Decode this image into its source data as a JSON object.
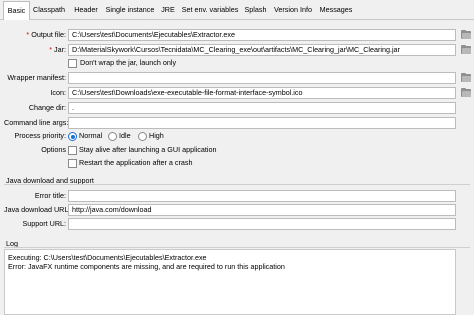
{
  "tabs": [
    {
      "label": "Basic",
      "active": true
    },
    {
      "label": "Classpath",
      "active": false
    },
    {
      "label": "Header",
      "active": false
    },
    {
      "label": "Single instance",
      "active": false
    },
    {
      "label": "JRE",
      "active": false
    },
    {
      "label": "Set env. variables",
      "active": false
    },
    {
      "label": "Splash",
      "active": false
    },
    {
      "label": "Version Info",
      "active": false
    },
    {
      "label": "Messages",
      "active": false
    }
  ],
  "basic": {
    "required_marker": "*",
    "output_file": {
      "label": "Output file:",
      "value": "C:\\Users\\test\\Documents\\Ejecutables\\Extractor.exe"
    },
    "jar": {
      "label": "Jar:",
      "value": "D:\\MaterialSkywork\\Cursos\\Tecnidata\\MC_Clearing_exe\\out\\artifacts\\MC_Clearing_jar\\MC_Clearing.jar"
    },
    "dont_wrap_label": "Don't wrap the jar, launch only",
    "wrapper_manifest": {
      "label": "Wrapper manifest:",
      "value": ""
    },
    "icon": {
      "label": "Icon:",
      "value": "C:\\Users\\test\\Downloads\\exe-executable-file-format-interface-symbol.ico"
    },
    "change_dir": {
      "label": "Change dir:",
      "value": "."
    },
    "command_line_args": {
      "label": "Command line args:",
      "value": ""
    },
    "process_priority": {
      "label": "Process priority:",
      "options": [
        "Normal",
        "Idle",
        "High"
      ],
      "selected": "Normal"
    },
    "options": {
      "label": "Options",
      "stay_alive": "Stay alive after launching a GUI application",
      "restart": "Restart the application after a crash"
    }
  },
  "java_download": {
    "section_title": "Java download and support",
    "error_title": {
      "label": "Error title:",
      "value": ""
    },
    "download_url": {
      "label": "Java download URL:",
      "value": "http://java.com/download"
    },
    "support_url": {
      "label": "Support URL:",
      "value": ""
    }
  },
  "log": {
    "section_title": "Log",
    "lines": [
      "Executing: C:\\Users\\test\\Documents\\Ejecutables\\Extractor.exe",
      "Error: JavaFX runtime components are missing, and are required to run this application"
    ]
  },
  "icons": {
    "browse": "folder-icon",
    "accent": "#1a6fd8",
    "required": "#d00000"
  }
}
